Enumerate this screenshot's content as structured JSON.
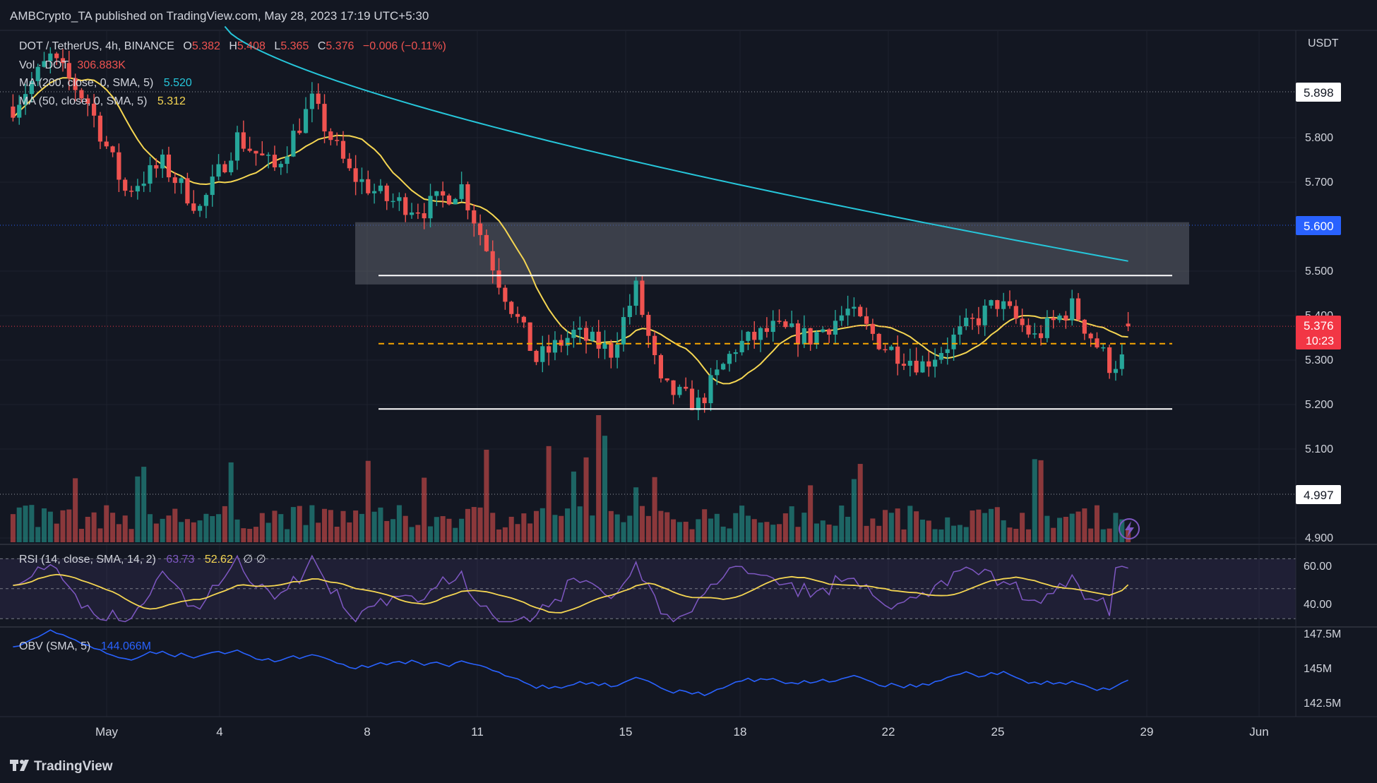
{
  "header": {
    "published": "AMBCrypto_TA published on TradingView.com, May 28, 2023 17:19 UTC+5:30"
  },
  "legend": {
    "symbol": "DOT / TetherUS, 4h, BINANCE",
    "o_label": "O",
    "o_val": "5.382",
    "h_label": "H",
    "h_val": "5.408",
    "l_label": "L",
    "l_val": "5.365",
    "c_label": "C",
    "c_val": "5.376",
    "change": "−0.006 (−0.11%)",
    "vol_label": "Vol · DOT",
    "vol_val": "306.883K",
    "ma200_label": "MA (200, close, 0, SMA, 5)",
    "ma200_val": "5.520",
    "ma50_label": "MA (50, close, 0, SMA, 5)",
    "ma50_val": "5.312",
    "rsi_label": "RSI (14, close, SMA, 14, 2)",
    "rsi_val": "63.73",
    "rsi_ma_val": "52.62",
    "rsi_extra": "∅  ∅",
    "obv_label": "OBV (SMA, 5)",
    "obv_val": "144.066M"
  },
  "price_axis": {
    "unit": "USDT",
    "ticks": [
      "5.800",
      "5.700",
      "5.500",
      "5.400",
      "5.300",
      "5.200",
      "5.100",
      "4.900"
    ],
    "marker_high": "5.898",
    "marker_mid": "5.600",
    "marker_low": "4.997",
    "current_price": "5.376",
    "countdown": "10:23"
  },
  "rsi_axis": {
    "ticks": [
      "60.00",
      "40.00"
    ]
  },
  "obv_axis": {
    "ticks": [
      "147.5M",
      "145M",
      "142.5M"
    ]
  },
  "time_axis": {
    "labels": [
      "May",
      "4",
      "8",
      "11",
      "15",
      "18",
      "22",
      "25",
      "29",
      "Jun"
    ]
  },
  "footer": {
    "brand": "TradingView"
  },
  "colors": {
    "up": "#26a69a",
    "down": "#ef5350",
    "ma200": "#26c6da",
    "ma50": "#f5d652",
    "rsi": "#7e57c2",
    "obv": "#2962ff",
    "support": "#ffffff",
    "zone": "#5d606b"
  },
  "chart_data": {
    "type": "candlestick",
    "timeframe": "4h",
    "x_range": [
      "Apr 30 2023",
      "Jun 1 2023"
    ],
    "y_range": [
      4.88,
      6.0
    ],
    "candles_shown": 180,
    "resistance_zone": {
      "low": 5.47,
      "high": 5.61
    },
    "support_lines": [
      5.19,
      5.49
    ],
    "mid_line": 5.337,
    "last": {
      "open": 5.382,
      "high": 5.408,
      "low": 5.365,
      "close": 5.376
    },
    "ma200_last": 5.52,
    "ma50_last": 5.312,
    "rsi_last": 63.73,
    "rsi_ma_last": 52.62,
    "obv_last": "144.066M"
  }
}
